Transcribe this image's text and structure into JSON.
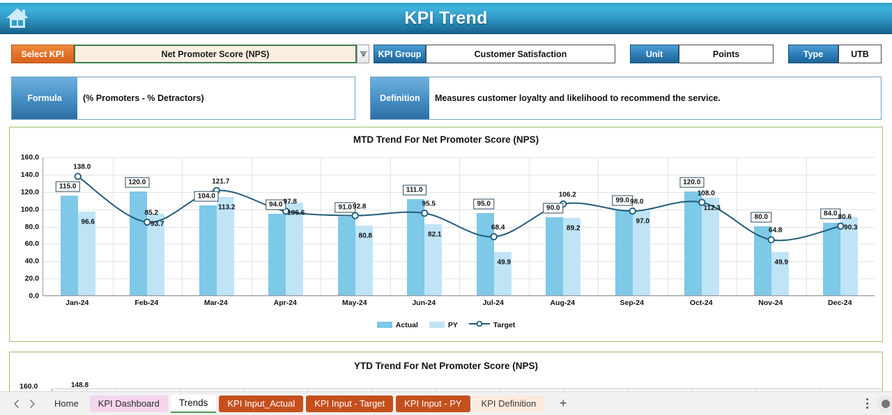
{
  "titlebar": {
    "title": "KPI Trend",
    "home_icon": "home-icon"
  },
  "selector_row": {
    "select_kpi_label": "Select KPI",
    "select_kpi_value": "Net Promoter Score (NPS)",
    "dropdown_icon": "chevron-down-icon",
    "kpi_group_label": "KPI Group",
    "kpi_group_value": "Customer Satisfaction",
    "unit_label": "Unit",
    "unit_value": "Points",
    "type_label": "Type",
    "type_value": "UTB"
  },
  "info_row": {
    "formula_label": "Formula",
    "formula_value": "(% Promoters - % Detractors)",
    "definition_label": "Definition",
    "definition_value": "Measures customer loyalty and likelihood to recommend the service."
  },
  "chart_data": {
    "type": "bar",
    "title": "MTD Trend For Net Promoter Score (NPS)",
    "xlabel": "",
    "ylabel": "",
    "ylim": [
      0,
      160
    ],
    "yticks": [
      "0.0",
      "20.0",
      "40.0",
      "60.0",
      "80.0",
      "100.0",
      "120.0",
      "140.0",
      "160.0"
    ],
    "grid": true,
    "legend_position": "bottom",
    "categories": [
      "Jan-24",
      "Feb-24",
      "Mar-24",
      "Apr-24",
      "May-24",
      "Jun-24",
      "Jul-24",
      "Aug-24",
      "Sep-24",
      "Oct-24",
      "Nov-24",
      "Dec-24"
    ],
    "series": [
      {
        "name": "Actual",
        "type": "bar",
        "color": "#7EC8E8",
        "values": [
          115.0,
          120.0,
          104.0,
          94.0,
          91.0,
          111.0,
          95.0,
          90.0,
          99.0,
          120.0,
          80.0,
          84.0
        ]
      },
      {
        "name": "PY",
        "type": "bar",
        "color": "#BFE4F6",
        "values": [
          96.6,
          93.7,
          113.2,
          106.6,
          80.8,
          82.1,
          49.9,
          89.2,
          97.0,
          112.3,
          49.9,
          90.3
        ]
      },
      {
        "name": "Target",
        "type": "line",
        "color": "#1F5C77",
        "values": [
          138.0,
          85.2,
          121.7,
          97.8,
          92.8,
          95.5,
          68.4,
          106.2,
          98.0,
          108.0,
          64.8,
          80.6
        ]
      }
    ]
  },
  "ytd_chart": {
    "title": "YTD Trend For Net Promoter Score (NPS)",
    "visible_axis_tick": "160.0",
    "visible_data_label": "148.8"
  },
  "tabbar": {
    "prev_icon": "chevron-left-icon",
    "next_icon": "chevron-right-icon",
    "add_sheet_icon": "plus-icon",
    "menu_icon": "kebab-menu-icon",
    "tabs": [
      {
        "label": "Home",
        "style": "plain"
      },
      {
        "label": "KPI Dashboard",
        "style": "pink"
      },
      {
        "label": "Trends",
        "style": "active"
      },
      {
        "label": "KPI Input_Actual",
        "style": "orange"
      },
      {
        "label": "KPI Input - Target",
        "style": "orange"
      },
      {
        "label": "KPI Input - PY",
        "style": "orange"
      },
      {
        "label": "KPI Definition",
        "style": "peach"
      }
    ]
  },
  "legend": {
    "actual": "Actual",
    "py": "PY",
    "target": "Target"
  }
}
